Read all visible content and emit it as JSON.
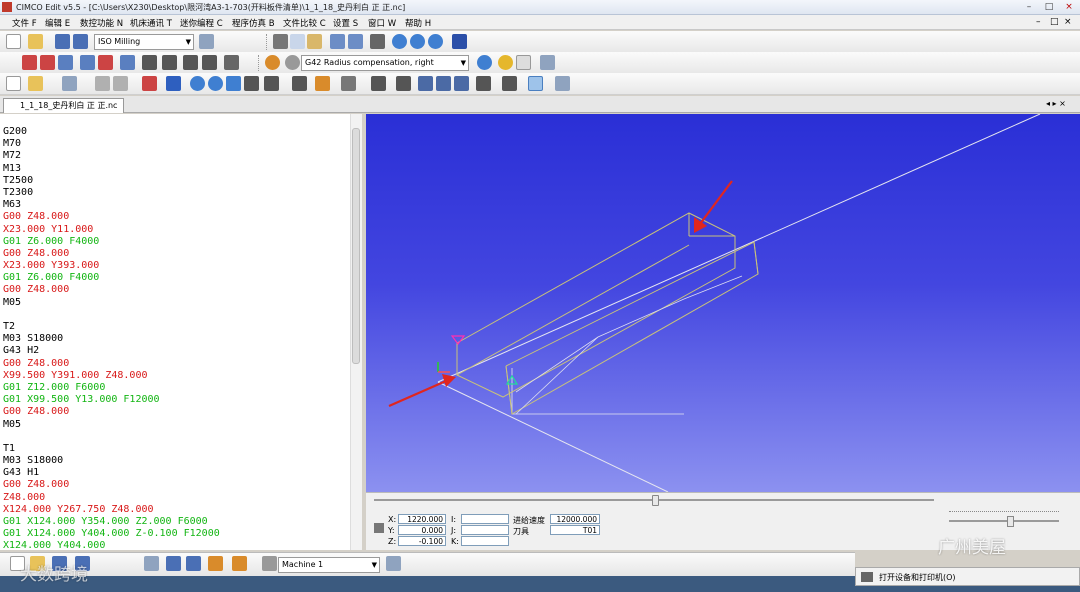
{
  "window": {
    "title": "CIMCO Edit v5.5 - [C:\\Users\\X230\\Desktop\\限河湾A3-1-703(开料板件清单)\\1_1_18_史丹利白 正 正.nc]",
    "buttons": [
      "–",
      "□",
      "×"
    ]
  },
  "menu": {
    "items": [
      "文件 F",
      "编辑 E",
      "数控功能 N",
      "机床通讯 T",
      "迷你编程 C",
      "程序仿真 B",
      "文件比较 C",
      "设置 S",
      "窗口 W",
      "帮助 H"
    ],
    "right_controls": [
      "–",
      "□",
      "×"
    ]
  },
  "toolbar1": {
    "machine_type": "ISO Milling"
  },
  "toolbar2": {
    "compensation": "G42 Radius compensation, right"
  },
  "tab": {
    "label": "1_1_18_史丹利白 正 正.nc",
    "nav": "◂ ▸ ×"
  },
  "code_lines": [
    {
      "t": "G200",
      "c": "black"
    },
    {
      "t": "M70",
      "c": "black"
    },
    {
      "t": "M72",
      "c": "black"
    },
    {
      "t": "M13",
      "c": "black"
    },
    {
      "t": "T2500",
      "c": "black"
    },
    {
      "t": "T2300",
      "c": "black"
    },
    {
      "t": "M63",
      "c": "black"
    },
    {
      "t": "G00 Z48.000",
      "c": "red"
    },
    {
      "t": "X23.000 Y11.000",
      "c": "red"
    },
    {
      "t": "G01 Z6.000 F4000",
      "c": "green"
    },
    {
      "t": "G00 Z48.000",
      "c": "red"
    },
    {
      "t": "X23.000 Y393.000",
      "c": "red"
    },
    {
      "t": "G01 Z6.000 F4000",
      "c": "green"
    },
    {
      "t": "G00 Z48.000",
      "c": "red"
    },
    {
      "t": "M05",
      "c": "black"
    },
    {
      "t": "",
      "c": "black"
    },
    {
      "t": "T2",
      "c": "black"
    },
    {
      "t": "M03 S18000",
      "c": "black"
    },
    {
      "t": "G43 H2",
      "c": "black"
    },
    {
      "t": "G00 Z48.000",
      "c": "red"
    },
    {
      "t": "X99.500 Y391.000 Z48.000",
      "c": "red"
    },
    {
      "t": "G01 Z12.000 F6000",
      "c": "green"
    },
    {
      "t": "G01 X99.500 Y13.000 F12000",
      "c": "green"
    },
    {
      "t": "G00 Z48.000",
      "c": "red"
    },
    {
      "t": "M05",
      "c": "black"
    },
    {
      "t": "",
      "c": "black"
    },
    {
      "t": "T1",
      "c": "black"
    },
    {
      "t": "M03 S18000",
      "c": "black"
    },
    {
      "t": "G43 H1",
      "c": "black"
    },
    {
      "t": "G00 Z48.000",
      "c": "red"
    },
    {
      "t": "Z48.000",
      "c": "red"
    },
    {
      "t": "X124.000 Y267.750 Z48.000",
      "c": "red"
    },
    {
      "t": "G01 X124.000 Y354.000 Z2.000 F6000",
      "c": "green"
    },
    {
      "t": "G01 X124.000 Y404.000 Z-0.100 F12000",
      "c": "green"
    },
    {
      "t": "X124.000 Y404.000",
      "c": "green"
    }
  ],
  "info": {
    "x_label": "X:",
    "x_value": "1220.000",
    "y_label": "Y:",
    "y_value": "0.000",
    "z_label": "Z:",
    "z_value": "-0.100",
    "i_label": "I:",
    "j_label": "J:",
    "k_label": "K:",
    "feed_label": "进给速度",
    "feed_value": "12000.000",
    "tool_label": "刀具",
    "tool_value": "T01"
  },
  "bottombar": {
    "machine": "Machine 1"
  },
  "watermarks": {
    "left": "大数跨境",
    "right": "广州美屋"
  },
  "printer_popup": "打开设备和打印机(O)",
  "colors": {
    "viewport_top": "#2a2fd6",
    "viewport_bottom": "#8c91f0",
    "code_red": "#d81818",
    "code_green": "#12b512",
    "arrow": "#e0261f"
  }
}
